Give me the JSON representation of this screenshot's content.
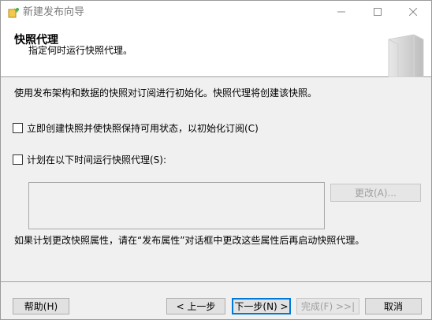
{
  "window": {
    "title": "新建发布向导",
    "app_icon": "wizard-app-icon",
    "controls": {
      "minimize": "minimize-icon",
      "maximize": "maximize-icon",
      "close": "close-icon"
    }
  },
  "header": {
    "title": "快照代理",
    "subtitle": "指定何时运行快照代理。",
    "art": "wizard-book-graphic"
  },
  "content": {
    "description": "使用发布架构和数据的快照对订阅进行初始化。快照代理将创建该快照。",
    "option_immediate": "立即创建快照并使快照保持可用状态，以初始化订阅(C)",
    "option_schedule": "计划在以下时间运行快照代理(S):",
    "change_button": "更改(A)...",
    "note": "如果计划更改快照属性，请在“发布属性”对话框中更改这些属性后再启动快照代理。"
  },
  "footer": {
    "help": "帮助(H)",
    "back": "< 上一步",
    "next": "下一步(N) >",
    "finish": "完成(F) >>|",
    "cancel": "取消"
  },
  "colors": {
    "window_bg": "#f0f0f0",
    "header_bg": "#ffffff",
    "default_button_border": "#0078d7",
    "disabled_text": "#a0a0a0"
  }
}
